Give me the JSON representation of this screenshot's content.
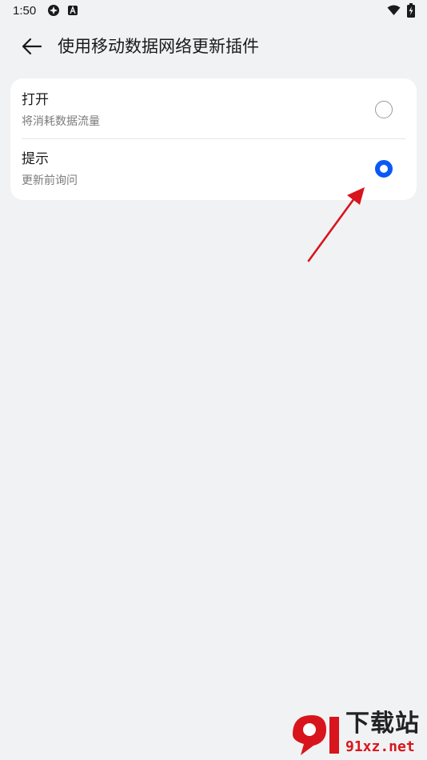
{
  "status_bar": {
    "time": "1:50",
    "icons": [
      "vpn-icon",
      "accessibility-a-icon",
      "wifi-icon",
      "battery-charging-icon"
    ]
  },
  "header": {
    "back_icon": "arrow-left-icon",
    "title": "使用移动数据网络更新插件"
  },
  "options": [
    {
      "title": "打开",
      "subtitle": "将消耗数据流量",
      "selected": false
    },
    {
      "title": "提示",
      "subtitle": "更新前询问",
      "selected": true
    }
  ],
  "colors": {
    "background": "#f1f2f4",
    "card": "#ffffff",
    "accent": "#0a59f7",
    "annotation": "#d8151c",
    "subtitle_text": "#7b7b7b"
  },
  "watermark": {
    "brand": "下载站",
    "url": "91xz.net"
  }
}
